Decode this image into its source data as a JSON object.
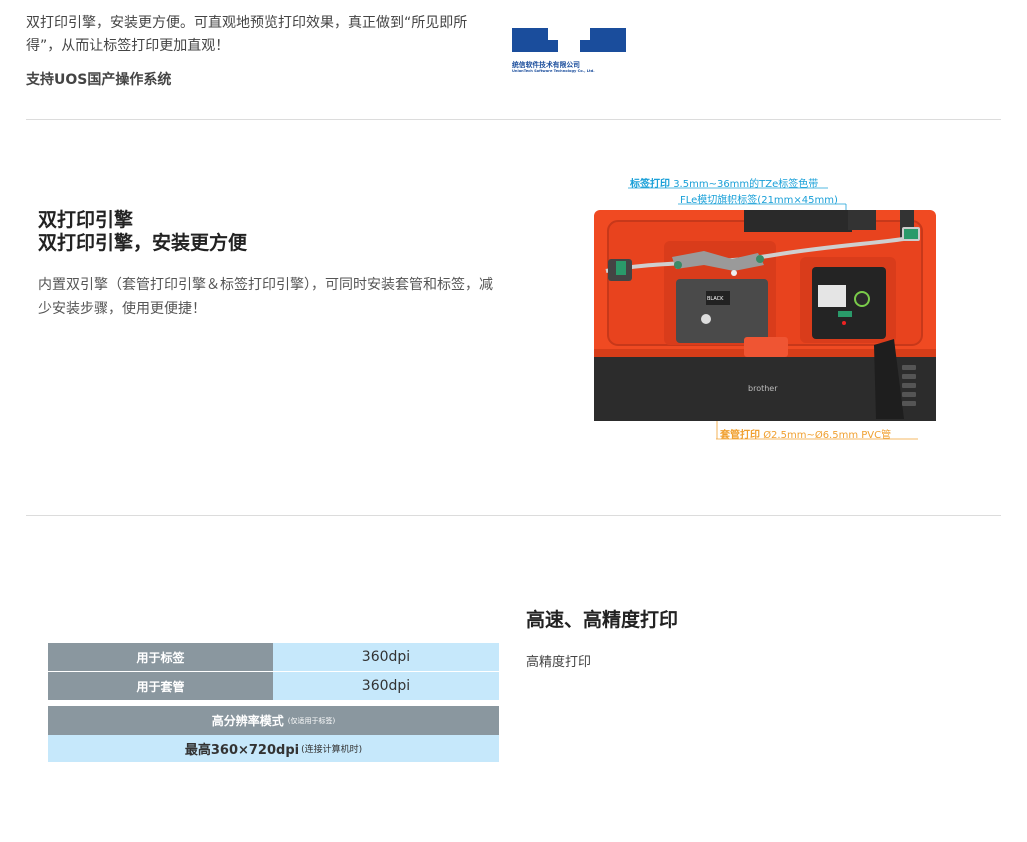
{
  "intro": {
    "paragraph": "双打印引擎，安装更方便。可直观地预览打印效果，真正做到“所见即所得”，从而让标签打印更加直观！",
    "uos": "支持UOS国产操作系统",
    "logo_name": "统信软件技术有限公司",
    "logo_sub": "UnionTech Software Technology Co., Ltd."
  },
  "engine": {
    "title_line1": "双打印引擎",
    "title_line2": "双打印引擎，安装更方便",
    "description": "内置双引擎（套管打印引擎＆标签打印引擎），可同时安装套管和标签，减少安装步骤，使用更便捷！",
    "image": {
      "label_caption_bold": "标签打印",
      "label_caption_rest": "3.5mm~36mm的TZe标签色带",
      "label_caption_2": "FLe模切旗帜标签(21mm×45mm)",
      "tube_caption_bold": "套管打印",
      "tube_caption_rest": "Ø2.5mm~Ø6.5mm   PVC管",
      "brand": "brother",
      "cassette_text": "BLACK"
    }
  },
  "precision": {
    "title": "高速、高精度打印",
    "description": "高精度打印",
    "table": {
      "rows": [
        {
          "key": "用于标签",
          "value": "360dpi"
        },
        {
          "key": "用于套管",
          "value": "360dpi"
        }
      ],
      "hr_title": "高分辨率模式",
      "hr_note": "(仅适用于标签)",
      "hr_value": "最高360×720dpi",
      "hr_value_note": "(连接计算机时)"
    }
  },
  "colors": {
    "accent_blue": "#1aa0d8",
    "accent_orange": "#f0a030",
    "logo_blue": "#1a4d9c",
    "table_gray": "#8a979f",
    "table_light": "#c6e8fb"
  }
}
